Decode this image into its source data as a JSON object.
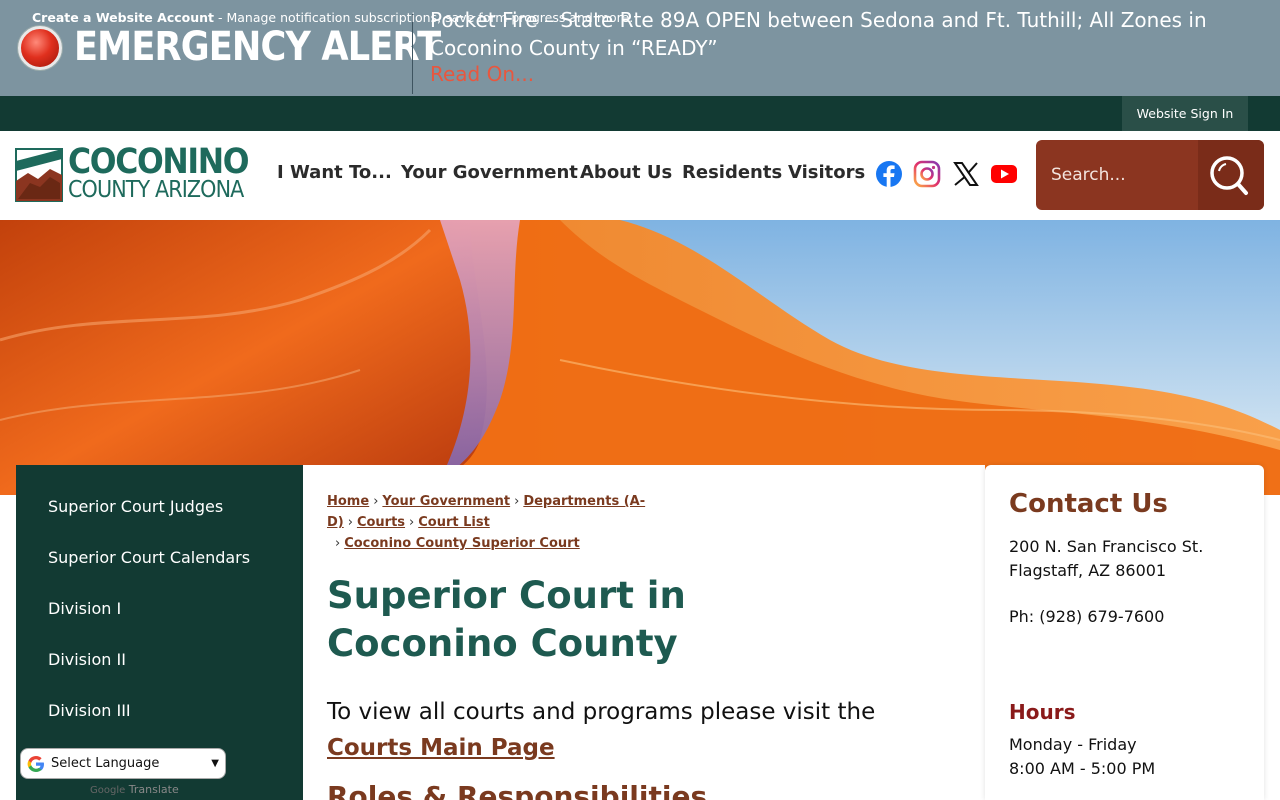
{
  "alert": {
    "title": "EMERGENCY ALERT",
    "message": "Pocket Fire – State Rte 89A OPEN between Sedona and Ft. Tuthill; All Zones in Coconino County in “READY”",
    "read_on": "Read On..."
  },
  "account_bar": {
    "create_account": "Create a Website Account",
    "description": " - Manage notification subscriptions, save form progress and more.",
    "sign_in": "Website Sign In"
  },
  "logo": {
    "line1": "COCONINO",
    "line2": "COUNTY ARIZONA"
  },
  "nav": {
    "items": [
      "I Want To...",
      "Your Government",
      "About Us",
      "Residents",
      "Visitors"
    ]
  },
  "social": [
    "facebook-icon",
    "instagram-icon",
    "x-icon",
    "youtube-icon"
  ],
  "search": {
    "placeholder": "Search..."
  },
  "side_nav": {
    "items": [
      "Superior Court Judges",
      "Superior Court Calendars",
      "Division I",
      "Division II",
      "Division III"
    ]
  },
  "translate": {
    "select_label": "Select Language",
    "powered_by": "Google",
    "translate": "Translate"
  },
  "breadcrumb": {
    "items": [
      "Home",
      "Your Government",
      "Departments (A-D)",
      "Courts",
      "Court List",
      "Coconino County Superior Court"
    ],
    "separator": "›"
  },
  "main": {
    "title": "Superior Court in Coconino County",
    "intro_prefix": "To view all courts and programs please visit the ",
    "intro_link": "Courts Main Page",
    "sub_heading": "Roles & Responsibilities"
  },
  "contact": {
    "title": "Contact Us",
    "address1": "200 N. San Francisco St.",
    "address2": "Flagstaff, AZ 86001",
    "phone": "Ph: (928) 679-7600",
    "hours_title": "Hours",
    "hours_days": "Monday - Friday",
    "hours_time": "8:00 AM - 5:00 PM"
  },
  "colors": {
    "alert_bg": "#7d94a0",
    "dark_green": "#123a33",
    "brand_green": "#1e6a5c",
    "rust": "#8b3520",
    "link_brown": "#7a3a1f"
  }
}
